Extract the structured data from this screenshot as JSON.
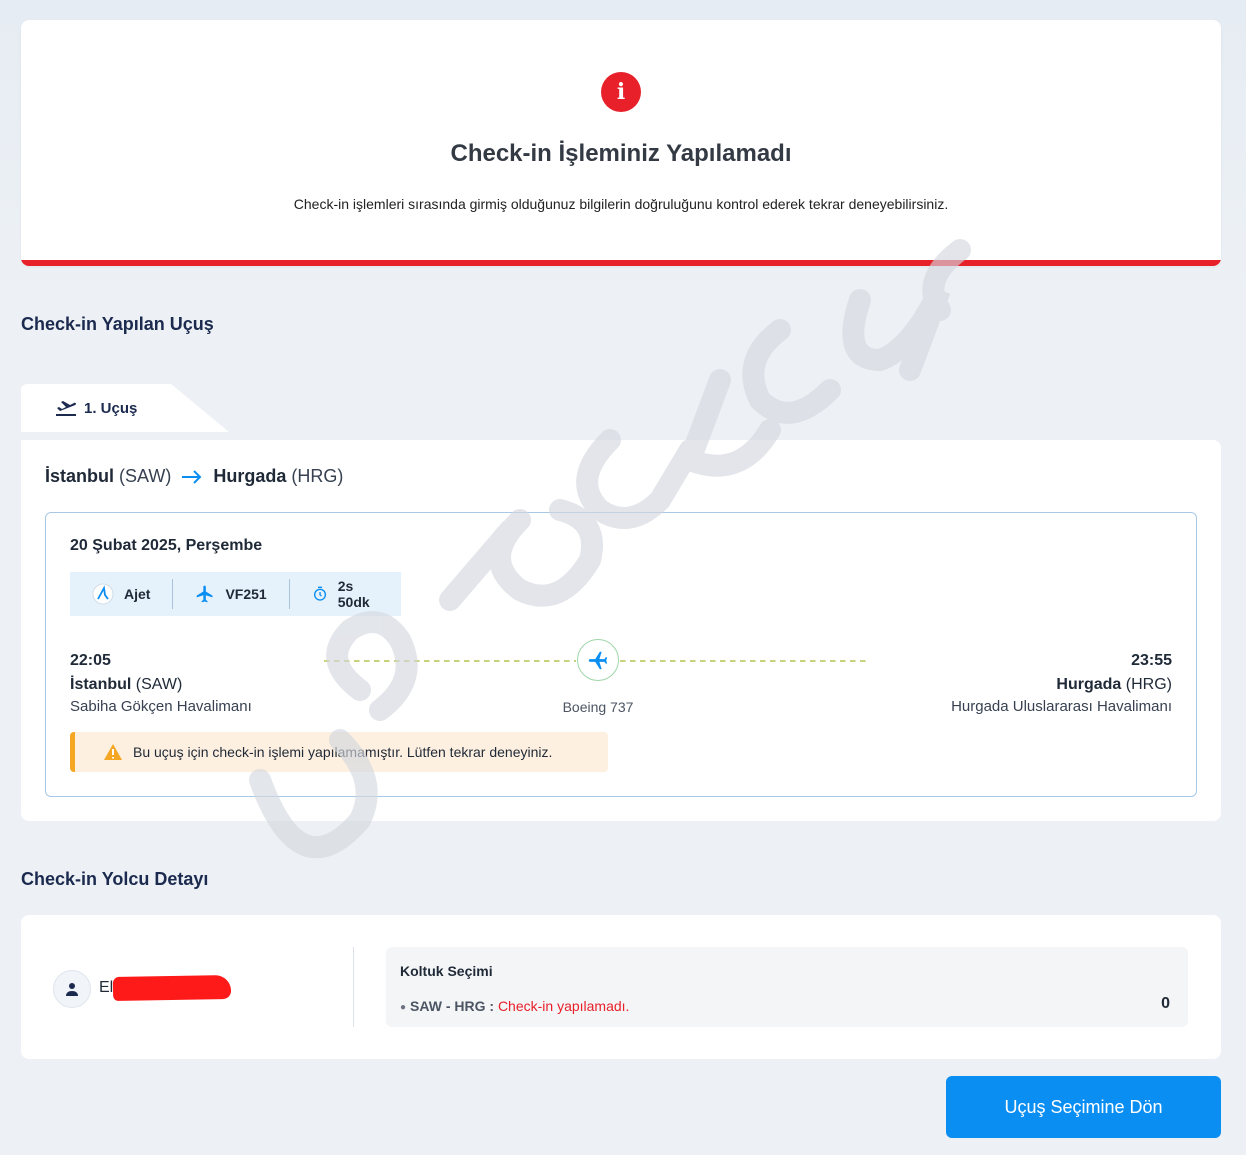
{
  "error": {
    "icon": "info-icon",
    "title": "Check-in İşleminiz Yapılamadı",
    "description": "Check-in işlemleri sırasında girmiş olduğunuz bilgilerin doğruluğunu kontrol ederek tekrar deneyebilirsiniz.",
    "accent_color": "#e8202a"
  },
  "flight_section": {
    "title": "Check-in Yapılan Uçuş",
    "tab_label": "1. Uçuş",
    "tab_icon": "plane-departure-icon",
    "route": {
      "from_city": "İstanbul",
      "from_code": "(SAW)",
      "to_city": "Hurgada",
      "to_code": "(HRG)"
    },
    "date": "20 Şubat 2025, Perşembe",
    "info": {
      "airline": "Ajet",
      "flight_no": "VF251",
      "duration": "2s 50dk"
    },
    "departure": {
      "time": "22:05",
      "city": "İstanbul",
      "code": "(SAW)",
      "airport": "Sabiha Gökçen Havalimanı"
    },
    "arrival": {
      "time": "23:55",
      "city": "Hurgada",
      "code": "(HRG)",
      "airport": "Hurgada Uluslararası Havalimanı"
    },
    "aircraft": "Boeing 737",
    "warning": "Bu uçuş için check-in işlemi yapılamamıştır. Lütfen tekrar deneyiniz."
  },
  "passenger_section": {
    "title": "Check-in Yolcu Detayı",
    "passenger_name": "El",
    "seat": {
      "title": "Koltuk Seçimi",
      "route": "SAW - HRG :",
      "status": "Check-in yapılamadı.",
      "count": "0"
    }
  },
  "actions": {
    "back_label": "Uçuş Seçimine Dön"
  },
  "watermark": "şikayetvar",
  "colors": {
    "primary": "#0a8ef2",
    "error": "#e8202a",
    "warning": "#f5a623"
  }
}
